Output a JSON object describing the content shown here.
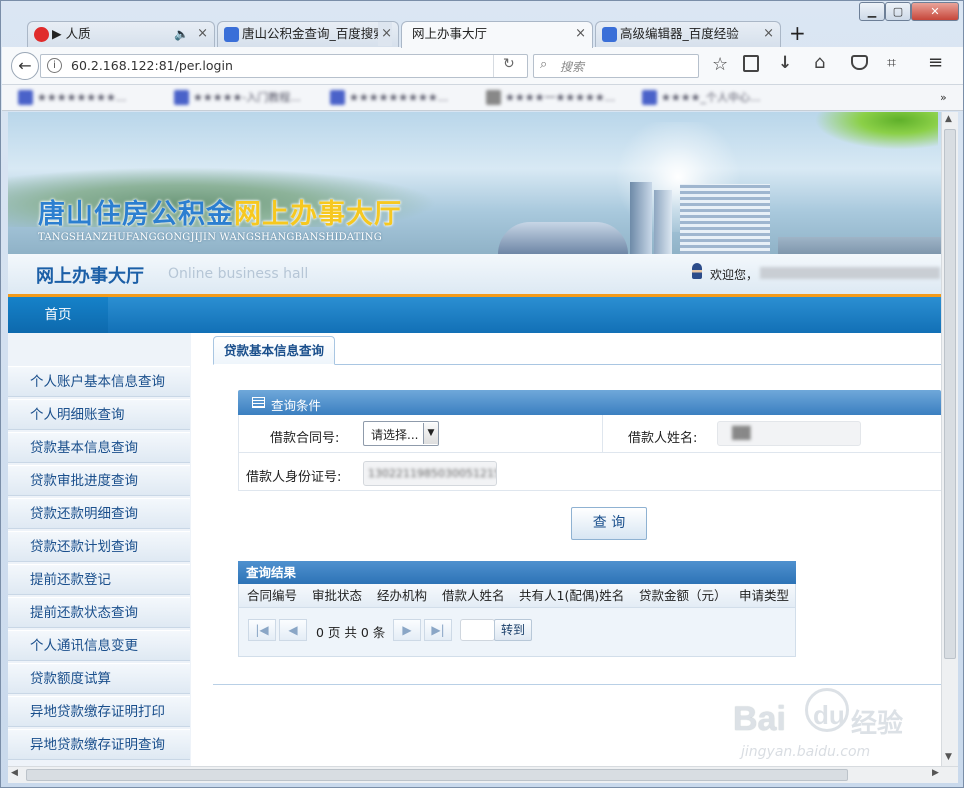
{
  "browser": {
    "tabs": [
      {
        "label": "▶ 人质",
        "icon": "netease-music-icon",
        "color": "#e02b2b"
      },
      {
        "label": "唐山公积金查询_百度搜索",
        "icon": "baidu-paw-icon",
        "color": "#3a6fd8"
      },
      {
        "label": "网上办事大厅",
        "icon": "",
        "color": ""
      },
      {
        "label": "高级编辑器_百度经验",
        "icon": "baidu-paw-icon",
        "color": "#3a6fd8"
      }
    ],
    "new_tab": "+",
    "url": "60.2.168.122:81/per.login",
    "search_placeholder": "搜索",
    "bookmarks": [
      "★★★★★★★★...",
      "★★★★★-入门教程...",
      "★★★★★★★★★...",
      "★★★★一★★★★★...",
      "★★★★_个人中心..."
    ],
    "bookmarks_more": "»"
  },
  "site": {
    "banner_title_1": "唐山住房公积金",
    "banner_title_2": "网上办事大厅",
    "banner_pinyin": "TANGSHANZHUFANGGONGJIJIN WANGSHANGBANSHIDATING",
    "hall_title": "网上办事大厅",
    "hall_subtitle": "Online business hall",
    "welcome": "欢迎您，",
    "menu_home": "首页"
  },
  "sidebar": {
    "items": [
      "个人账户基本信息查询",
      "个人明细账查询",
      "贷款基本信息查询",
      "贷款审批进度查询",
      "贷款还款明细查询",
      "贷款还款计划查询",
      "提前还款登记",
      "提前还款状态查询",
      "个人通讯信息变更",
      "贷款额度试算",
      "异地贷款缴存证明打印",
      "异地贷款缴存证明查询"
    ]
  },
  "main": {
    "tab": "贷款基本信息查询",
    "cond_title": "查询条件",
    "contract_label": "借款合同号:",
    "contract_select": "请选择...",
    "name_label": "借款人姓名:",
    "name_value": "██",
    "id_label": "借款人身份证号:",
    "id_value": "1302211985030051215",
    "query_button": "查 询",
    "result_title": "查询结果",
    "columns": [
      "合同编号",
      "审批状态",
      "经办机构",
      "借款人姓名",
      "共有人1(配偶)姓名",
      "贷款金额（元）",
      "申请类型"
    ],
    "pager_text": "0 页 共 0 条",
    "goto_button": "转到"
  },
  "watermark": {
    "brand": "Bai",
    "brand2": "du",
    "brand3": "经验",
    "url": "jingyan.baidu.com"
  },
  "colors": {
    "menu_blue": "#1a7cc4",
    "orange": "#f39b1b",
    "link_blue": "#1a4f8c",
    "title_blue": "#2c7fd0",
    "title_yellow": "#f6c820"
  }
}
